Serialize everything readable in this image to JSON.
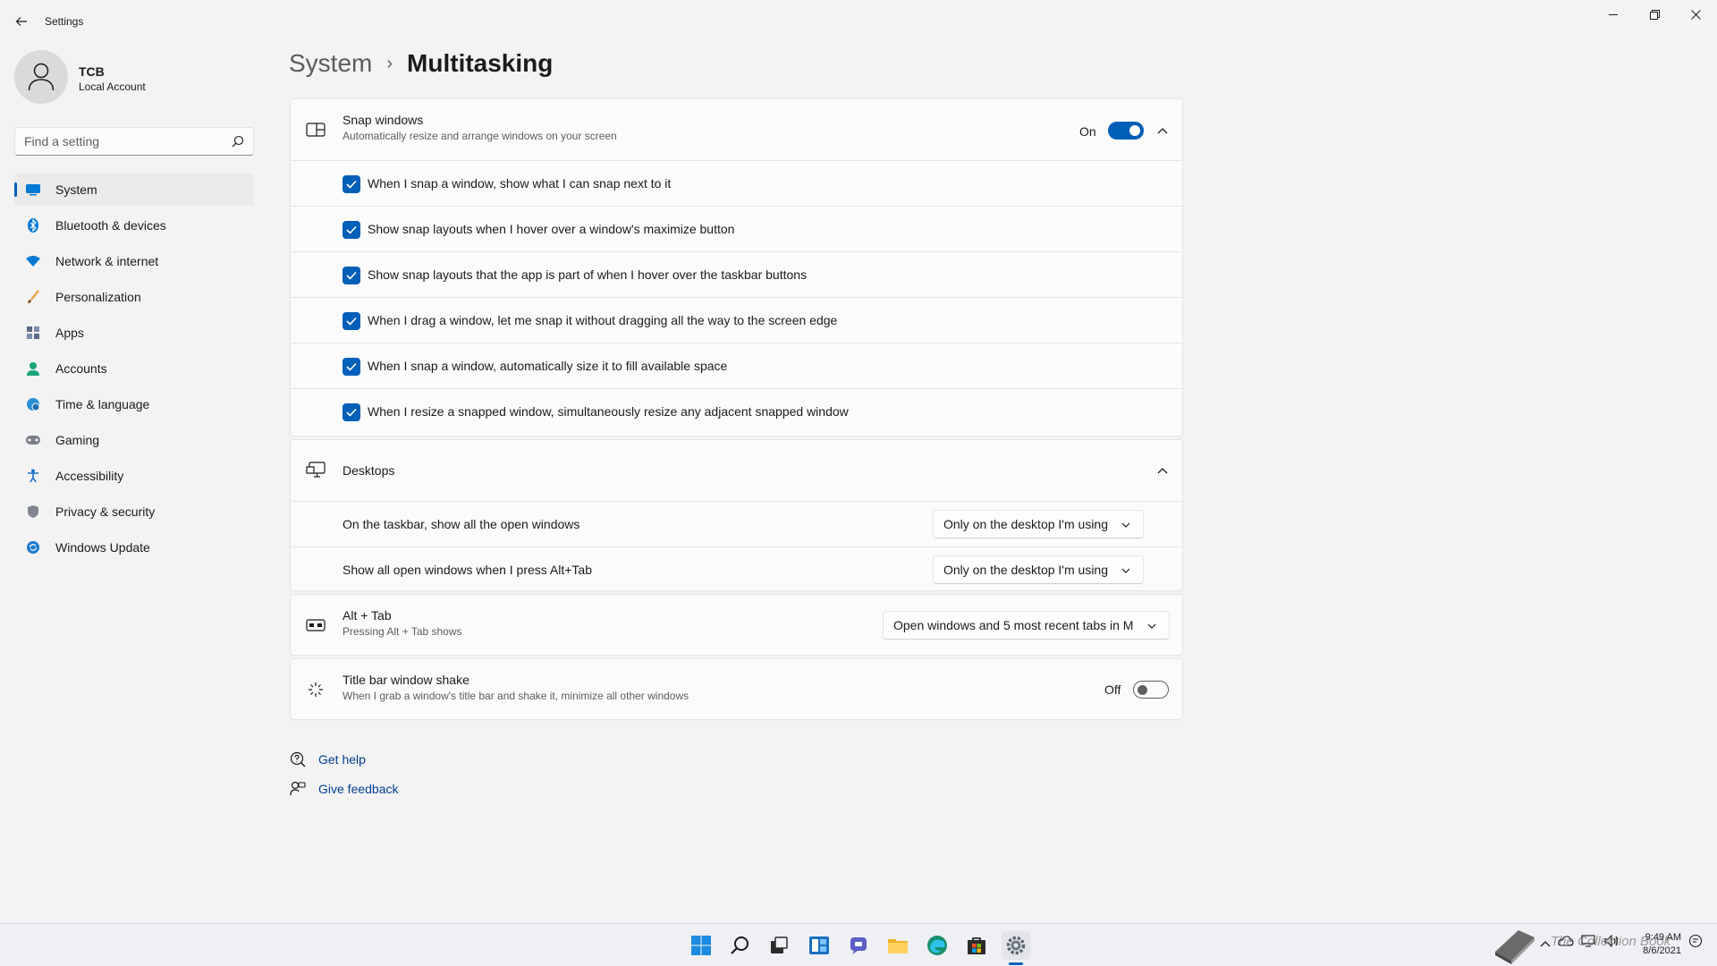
{
  "window": {
    "title": "Settings"
  },
  "profile": {
    "name": "TCB",
    "account_type": "Local Account"
  },
  "search": {
    "placeholder": "Find a setting"
  },
  "sidebar": {
    "items": [
      {
        "label": "System",
        "icon": "system-icon",
        "active": true
      },
      {
        "label": "Bluetooth & devices",
        "icon": "bluetooth-icon"
      },
      {
        "label": "Network & internet",
        "icon": "wifi-icon"
      },
      {
        "label": "Personalization",
        "icon": "brush-icon"
      },
      {
        "label": "Apps",
        "icon": "apps-icon"
      },
      {
        "label": "Accounts",
        "icon": "person-icon"
      },
      {
        "label": "Time & language",
        "icon": "globe-clock-icon"
      },
      {
        "label": "Gaming",
        "icon": "gamepad-icon"
      },
      {
        "label": "Accessibility",
        "icon": "accessibility-icon"
      },
      {
        "label": "Privacy & security",
        "icon": "shield-icon"
      },
      {
        "label": "Windows Update",
        "icon": "update-icon"
      }
    ]
  },
  "breadcrumb": {
    "parent": "System",
    "separator": "›",
    "current": "Multitasking"
  },
  "snap": {
    "title": "Snap windows",
    "subtitle": "Automatically resize and arrange windows on your screen",
    "state_label": "On",
    "enabled": true,
    "options": [
      {
        "label": "When I snap a window, show what I can snap next to it",
        "checked": true
      },
      {
        "label": "Show snap layouts when I hover over a window's maximize button",
        "checked": true
      },
      {
        "label": "Show snap layouts that the app is part of when I hover over the taskbar buttons",
        "checked": true
      },
      {
        "label": "When I drag a window, let me snap it without dragging all the way to the screen edge",
        "checked": true
      },
      {
        "label": "When I snap a window, automatically size it to fill available space",
        "checked": true
      },
      {
        "label": "When I resize a snapped window, simultaneously resize any adjacent snapped window",
        "checked": true
      }
    ]
  },
  "desktops": {
    "title": "Desktops",
    "rows": [
      {
        "label": "On the taskbar, show all the open windows",
        "value": "Only on the desktop I'm using"
      },
      {
        "label": "Show all open windows when I press Alt+Tab",
        "value": "Only on the desktop I'm using"
      }
    ]
  },
  "alttab": {
    "title": "Alt + Tab",
    "subtitle": "Pressing Alt + Tab shows",
    "value": "Open windows and 5 most recent tabs in M"
  },
  "shake": {
    "title": "Title bar window shake",
    "subtitle": "When I grab a window's title bar and shake it, minimize all other windows",
    "state_label": "Off",
    "enabled": false
  },
  "help": {
    "get_help": "Get help",
    "give_feedback": "Give feedback"
  },
  "taskbar": {
    "icons": [
      "start-icon",
      "search-icon",
      "task-view-icon",
      "widgets-icon",
      "chat-icon",
      "file-explorer-icon",
      "edge-icon",
      "store-icon",
      "settings-icon"
    ],
    "time": "9:49 AM",
    "date": "8/6/2021",
    "watermark": "The Collection Book"
  },
  "colors": {
    "accent": "#005fb8",
    "background": "#f3f3f3",
    "card": "#fbfbfb"
  }
}
